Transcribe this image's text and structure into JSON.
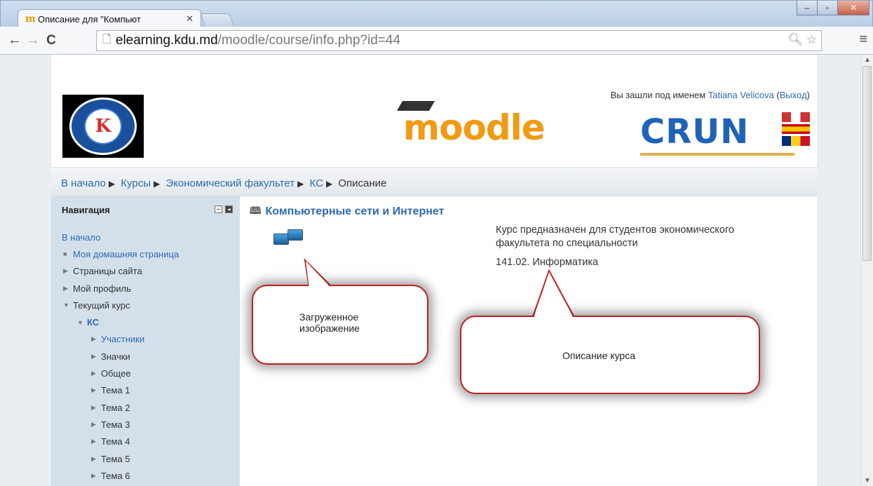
{
  "browser": {
    "tab_title": "Описание для \"Компьют",
    "tab_favicon": "moodle-favicon",
    "url_host": "elearning.kdu.md",
    "url_path": "/moodle/course/info.php?id=44"
  },
  "header": {
    "login_prefix": "Вы зашли под именем ",
    "user_name": "Tatiana Velicova",
    "logout": "Выход",
    "moodle_logo": "moodle",
    "crun_logo": "CRUN",
    "kdu_logo": "K"
  },
  "breadcrumb": {
    "items": [
      "В начало",
      "Курсы",
      "Экономический факультет",
      "КС",
      "Описание"
    ]
  },
  "navigation": {
    "title": "Навигация",
    "items": [
      {
        "label": "В начало"
      },
      {
        "label": "Моя домашняя страница"
      },
      {
        "label": "Страницы сайта"
      },
      {
        "label": "Мой профиль"
      },
      {
        "label": "Текущий курс"
      },
      {
        "label": "КС"
      },
      {
        "label": "Участники"
      },
      {
        "label": "Значки"
      },
      {
        "label": "Общее"
      },
      {
        "label": "Тема 1"
      },
      {
        "label": "Тема 2"
      },
      {
        "label": "Тема 3"
      },
      {
        "label": "Тема 4"
      },
      {
        "label": "Тема 5"
      },
      {
        "label": "Тема 6"
      }
    ]
  },
  "course": {
    "title": "Компьютерные сети и Интернет",
    "description_1": "Курс предназначен для студентов экономического факультета по специальности",
    "description_2": "141.02. Информатика"
  },
  "callouts": {
    "image_label": "Загруженное изображение",
    "description_label": "Описание курса"
  },
  "colors": {
    "link": "#2e6ab1",
    "nav_bg": "#d3e0ea",
    "callout_border": "#c02020",
    "moodle_orange": "#f29a12",
    "crun_blue": "#1f63b7"
  }
}
